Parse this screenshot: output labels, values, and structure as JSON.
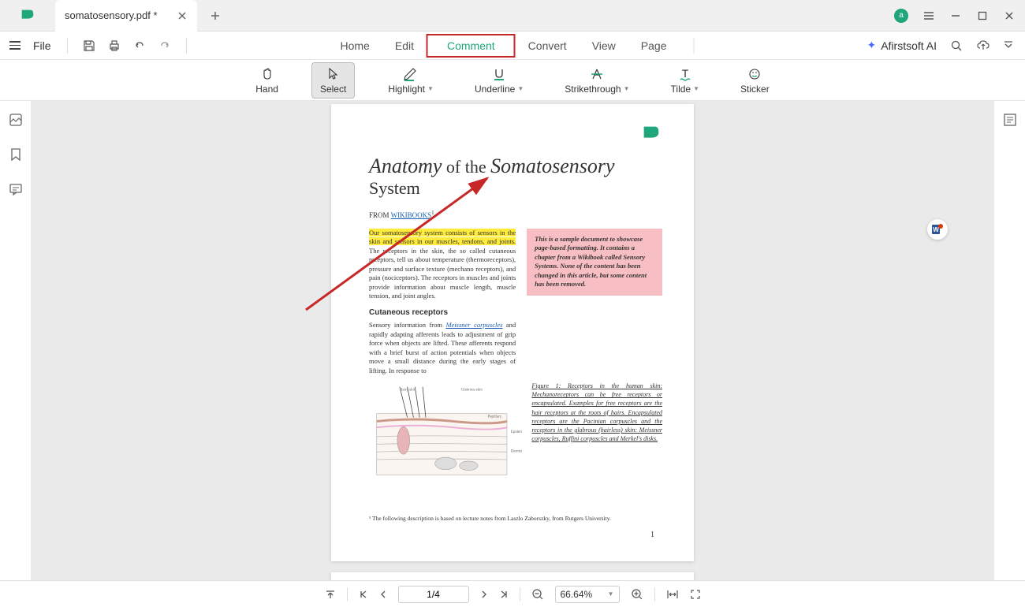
{
  "titlebar": {
    "tab_title": "somatosensory.pdf *",
    "avatar_letter": "a"
  },
  "menubar": {
    "file_label": "File",
    "items": [
      "Home",
      "Edit",
      "Comment",
      "Convert",
      "View",
      "Page"
    ],
    "active_index": 2,
    "ai_label": "Afirstsoft AI"
  },
  "toolbar": {
    "tools": [
      {
        "label": "Hand",
        "dropdown": false
      },
      {
        "label": "Select",
        "dropdown": false
      },
      {
        "label": "Highlight",
        "dropdown": true
      },
      {
        "label": "Underline",
        "dropdown": true
      },
      {
        "label": "Strikethrough",
        "dropdown": true
      },
      {
        "label": "Tilde",
        "dropdown": true
      },
      {
        "label": "Sticker",
        "dropdown": false
      }
    ],
    "selected_index": 1
  },
  "document": {
    "title_part1": "Anatomy",
    "title_part2": "of the",
    "title_part3": "Somatosensory",
    "title_part4": "System",
    "from_label": "FROM ",
    "from_link": "WIKIBOOKS",
    "highlighted": "Our somatosensory system consists of sensors in the skin and sensors in our muscles, tendons, and joints.",
    "body1": " The receptors in the skin, the so called cutaneous receptors, tell us about temperature (thermoreceptors), pressure and surface texture (mechano receptors), and pain (nociceptors). The receptors in muscles and joints provide information about muscle length, muscle tension, and joint angles.",
    "pinkbox": "This is a sample document to showcase page-based formatting. It contains a chapter from a Wikibook called Sensory Systems. None of the content has been changed in this article, but some content has been removed.",
    "subhead": "Cutaneous receptors",
    "body2a": "Sensory information from ",
    "body2_link": "Meissner corpuscles",
    "body2b": " and rapidly adapting afferents leads to adjustment of grip force when objects are lifted. These afferents respond with a brief burst of action potentials when objects move a small distance during the early stages of lifting. In response to",
    "fig_caption": "Figure 1: Receptors in the human skin: Mechanoreceptors can be free receptors or encapsulated. Examples for free receptors are the hair receptors at the roots of hairs. Encapsulated receptors are the Pacinian corpuscles and the receptors in the glabrous (hairless) skin: Meissner corpuscles, Ruffini corpuscles and Merkel's disks.",
    "footnote": "¹ The following description is based on lecture notes from Laszlo Zaborszky, from Rutgers University.",
    "page_number": "1"
  },
  "statusbar": {
    "page_display": "1/4",
    "zoom_display": "66.64%"
  }
}
